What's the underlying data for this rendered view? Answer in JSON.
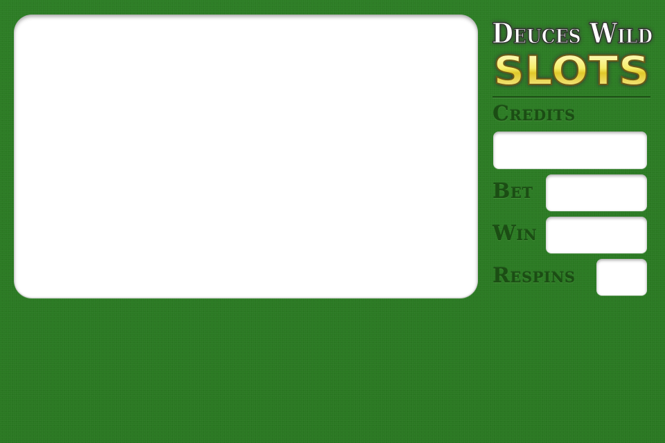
{
  "logo": {
    "line1": "Deuces Wild",
    "line2": "SLOTS"
  },
  "colors": {
    "felt": "#2b7a23",
    "label": "#1b4d14",
    "panel": "#ffffff",
    "slots_gold": "#f0e046"
  },
  "meters": {
    "credits": {
      "label": "Credits",
      "value": ""
    },
    "bet": {
      "label": "Bet",
      "value": ""
    },
    "win": {
      "label": "Win",
      "value": ""
    },
    "respins": {
      "label": "Respins",
      "value": ""
    }
  },
  "reels": {
    "symbols": []
  }
}
